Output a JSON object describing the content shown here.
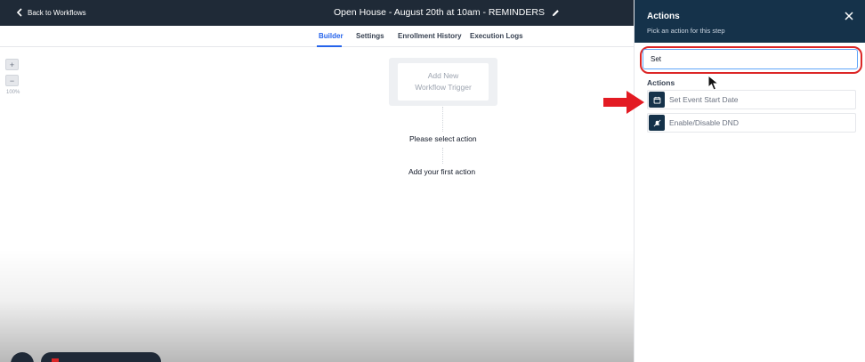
{
  "header": {
    "back_label": "Back to Workflows",
    "workflow_title": "Open House - August 20th at 10am - REMINDERS"
  },
  "tabs": [
    {
      "label": "Builder",
      "active": true
    },
    {
      "label": "Settings",
      "active": false
    },
    {
      "label": "Enrollment History",
      "active": false
    },
    {
      "label": "Execution Logs",
      "active": false
    }
  ],
  "zoom": {
    "in_label": "+",
    "out_label": "−",
    "level": "100%"
  },
  "canvas": {
    "trigger_line1": "Add New",
    "trigger_line2": "Workflow Trigger",
    "select_action": "Please select action",
    "first_action": "Add your first action"
  },
  "panel": {
    "title": "Actions",
    "subtitle": "Pick an action for this step",
    "search_value": "Set",
    "section_label": "Actions",
    "actions": [
      {
        "label": "Set Event Start Date",
        "icon": "calendar-icon"
      },
      {
        "label": "Enable/Disable DND",
        "icon": "bell-off-icon"
      }
    ]
  },
  "colors": {
    "topbar": "#1f2a37",
    "panel_header": "#15324a",
    "accent": "#2563eb",
    "highlight": "#dc2626"
  }
}
